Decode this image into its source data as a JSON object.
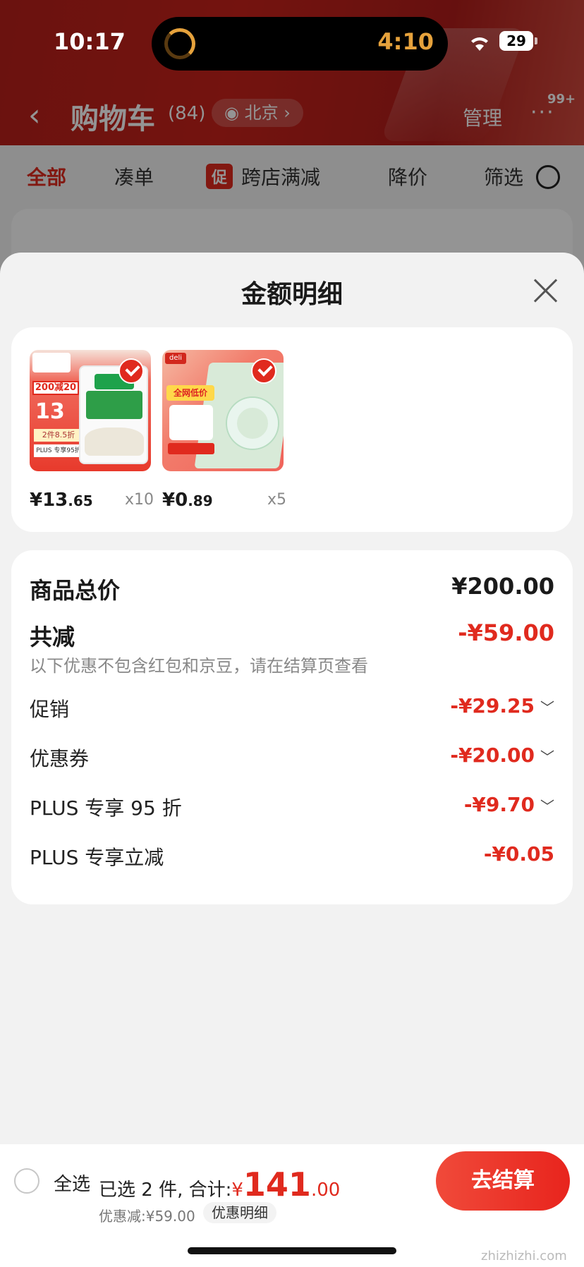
{
  "status_bar": {
    "time": "10:17",
    "timer": "4:10",
    "battery": "29"
  },
  "nav": {
    "back": "‹",
    "title": "购物车",
    "count": "(84)",
    "location": "北京 ›",
    "manage": "管理",
    "more": "···",
    "badge": "99+"
  },
  "tabs": {
    "all": "全部",
    "cou": "凑单",
    "cu_badge": "促",
    "cross_store": "跨店满减",
    "price_drop": "降价",
    "filter": "筛选"
  },
  "sheet": {
    "title": "金额明细",
    "products": [
      {
        "price_int": "¥13",
        "price_dec": ".65",
        "qty": "x10",
        "img_tag": "200减20",
        "img_big": "13",
        "img_line": "2件8.5折",
        "img_plus": "PLUS 专享95折"
      },
      {
        "price_int": "¥0",
        "price_dec": ".89",
        "qty": "x5",
        "img_logo": "deli",
        "img_label": "全网低价"
      }
    ],
    "details": {
      "total_label": "商品总价",
      "total_value": "¥200.00",
      "reduce_label": "共减",
      "reduce_value": "-¥59.00",
      "note": "以下优惠不包含红包和京豆，请在结算页查看",
      "items": [
        {
          "label": "促销",
          "value": "-¥29.25",
          "chevron": "﹀"
        },
        {
          "label": "优惠券",
          "value": "-¥20.00",
          "chevron": "﹀"
        },
        {
          "label": "PLUS 专享 95 折",
          "value": "-¥9.70",
          "chevron": "﹀"
        },
        {
          "label": "PLUS 专享立减",
          "value": "-¥0.05",
          "chevron": ""
        }
      ]
    }
  },
  "bottom_bar": {
    "select_all": "全选",
    "selected_text": "已选 2 件, 合计:",
    "yen": "¥",
    "total_int": "141",
    "total_dec": ".00",
    "discount": "优惠减:¥59.00",
    "detail_link": "优惠明细",
    "checkout": "去结算",
    "watermark": "zhizhizhi.com"
  },
  "colors": {
    "accent": "#e02a1e",
    "header_red": "#c8221b",
    "timer_orange": "#e6a23c"
  }
}
